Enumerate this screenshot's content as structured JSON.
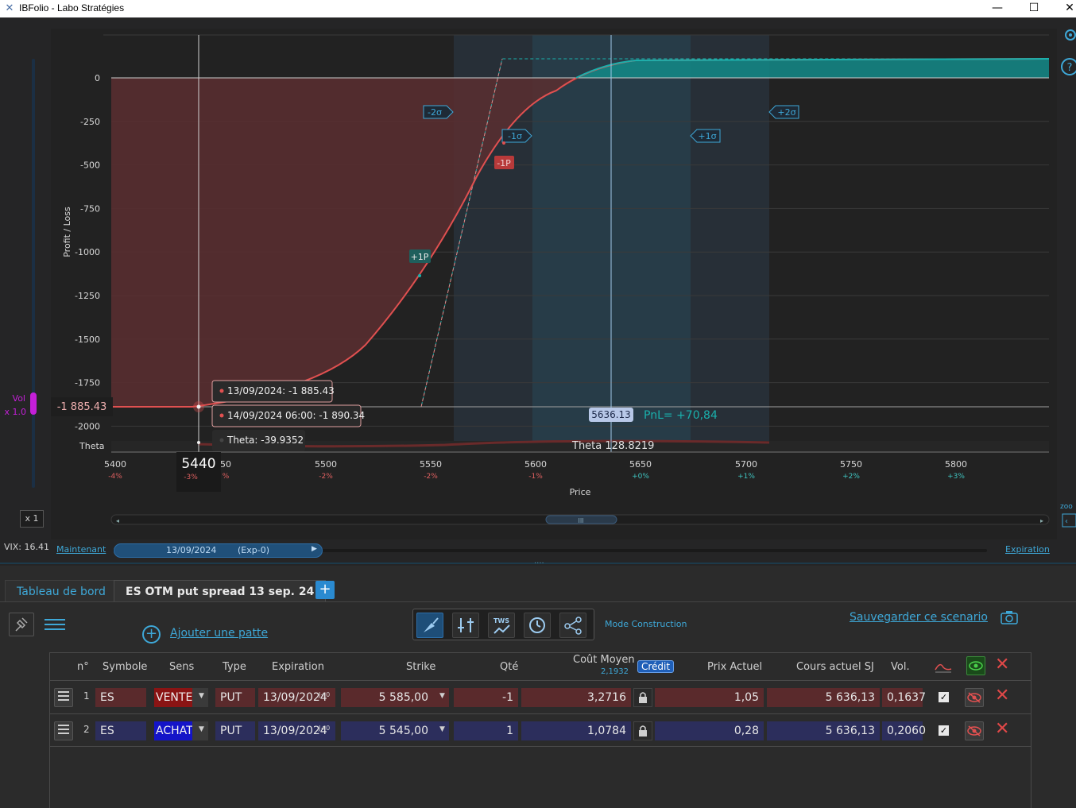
{
  "window": {
    "title": "IBFolio - Labo Stratégies",
    "minimize": "—",
    "maximize": "☐",
    "close": "✕"
  },
  "chart": {
    "ylabel": "Profit / Loss",
    "xlabel": "Price",
    "y_ticks": [
      "0",
      "-250",
      "-500",
      "-750",
      "-1000",
      "-1250",
      "-1500",
      "-1750",
      "-2000"
    ],
    "x_ticks": [
      {
        "label": "5400",
        "pct": "-4%",
        "sign": "neg"
      },
      {
        "label": "50",
        "pct": "%",
        "sign": "neg"
      },
      {
        "label": "5500",
        "pct": "-2%",
        "sign": "neg"
      },
      {
        "label": "5550",
        "pct": "-2%",
        "sign": "neg"
      },
      {
        "label": "5600",
        "pct": "-1%",
        "sign": "neg"
      },
      {
        "label": "5650",
        "pct": "+0%",
        "sign": "pos"
      },
      {
        "label": "5700",
        "pct": "+1%",
        "sign": "pos"
      },
      {
        "label": "5750",
        "pct": "+2%",
        "sign": "pos"
      },
      {
        "label": "5800",
        "pct": "+3%",
        "sign": "pos"
      }
    ],
    "sigma_markers": [
      "-2σ",
      "-1σ",
      "+1σ",
      "+2σ"
    ],
    "leg_markers": [
      "+1P",
      "-1P"
    ],
    "cursor_price": "5440",
    "cursor_pct": "-3%",
    "cursor_pnl": "-1 885.43",
    "tooltip_1": "13/09/2024: -1 885.43",
    "tooltip_2": "14/09/2024 06:00: -1 890.34",
    "tooltip_theta": "Theta: -39.9352",
    "theta_label": "Theta",
    "theta_value": "Theta 128.8219",
    "current_price": "5636.13",
    "current_pnl": "PnL= +70,84",
    "colors": {
      "loss": "#e05050",
      "profit": "#1ab0ac",
      "accent": "#3ea8d8"
    }
  },
  "left_panel": {
    "vol_label": "Vol",
    "vol_mult": "x 1.0",
    "x1_button": "x 1",
    "vix": "VIX: 16.41"
  },
  "timeline": {
    "now_link": "Maintenant",
    "date": "13/09/2024",
    "exp": "(Exp-0)",
    "expiration_link": "Expiration"
  },
  "side": {
    "zoom_label": "zoo",
    "help": "?"
  },
  "tabs": {
    "dashboard": "Tableau de bord",
    "strategy": "ES OTM put spread 13 sep. 24",
    "add": "+"
  },
  "toolbar": {
    "add_leg": "Ajouter une patte",
    "mode": "Mode Construction",
    "tws_label": "TWS",
    "save_scenario": "Sauvegarder ce scenario"
  },
  "table": {
    "headers": {
      "num": "n°",
      "symbol": "Symbole",
      "sens": "Sens",
      "type": "Type",
      "expiration": "Expiration",
      "strike": "Strike",
      "qty": "Qté",
      "avg_cost": "Coût Moyen",
      "avg_cost_sub": "2,1932",
      "credit": "Crédit",
      "price": "Prix Actuel",
      "underlying": "Cours actuel SJ",
      "vol": "Vol."
    },
    "rows": [
      {
        "num": "1",
        "symbol": "ES",
        "sens": "VENTE",
        "type": "PUT",
        "day_tag": "J+0",
        "expiration": "13/09/2024",
        "strike": "5 585,00",
        "qty": "-1",
        "avg_cost": "3,2716",
        "price": "1,05",
        "underlying": "5 636,13",
        "vol": "0,1637",
        "check": "✓",
        "delete": "✕"
      },
      {
        "num": "2",
        "symbol": "ES",
        "sens": "ACHAT",
        "type": "PUT",
        "day_tag": "J+0",
        "expiration": "13/09/2024",
        "strike": "5 545,00",
        "qty": "1",
        "avg_cost": "1,0784",
        "price": "0,28",
        "underlying": "5 636,13",
        "vol": "0,2060",
        "check": "✓",
        "delete": "✕"
      }
    ],
    "header_delete": "✕"
  }
}
